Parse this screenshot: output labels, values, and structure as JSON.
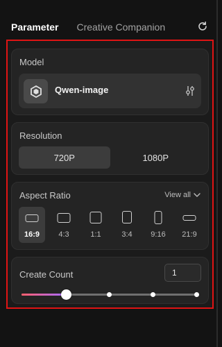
{
  "tabs": {
    "active": "Parameter",
    "inactive": "Creative Companion"
  },
  "model": {
    "title": "Model",
    "name": "Qwen-image"
  },
  "resolution": {
    "title": "Resolution",
    "options": [
      "720P",
      "1080P"
    ],
    "selected": "720P"
  },
  "aspect": {
    "title": "Aspect Ratio",
    "view_all": "View all",
    "options": [
      "16:9",
      "4:3",
      "1:1",
      "3:4",
      "9:16",
      "21:9"
    ],
    "selected": "16:9"
  },
  "count": {
    "title": "Create Count",
    "value": "1",
    "slider_fraction": 0.25
  },
  "colors": {
    "frame": "#e01414",
    "slider_start": "#ff5f6d",
    "slider_end": "#a56bff",
    "background": "#131313"
  }
}
